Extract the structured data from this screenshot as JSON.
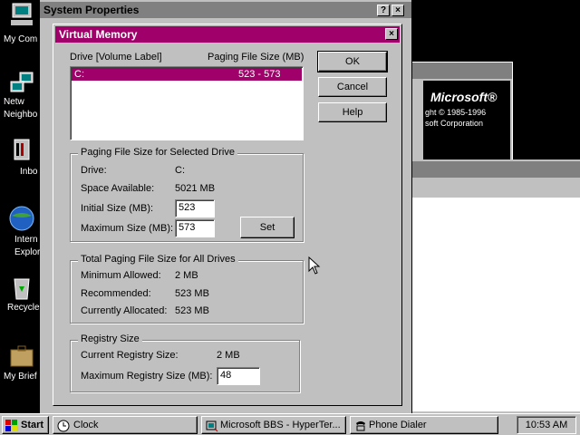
{
  "desktop": {
    "icons": [
      {
        "label": "My Com",
        "icon": "my-computer-icon"
      },
      {
        "label": "Netw\nNeighbo",
        "icon": "network-neighborhood-icon"
      },
      {
        "label": "Inbo",
        "icon": "inbox-icon"
      },
      {
        "label": "Intern\nExplor",
        "icon": "internet-explorer-icon"
      },
      {
        "label": "Recycle",
        "icon": "recycle-bin-icon"
      },
      {
        "label": "My Brief",
        "icon": "briefcase-icon"
      }
    ]
  },
  "system_properties": {
    "title": "System Properties",
    "help_glyph": "?",
    "close_glyph": "×"
  },
  "about_window": {
    "brand": "Microsoft®",
    "copyright": "ght © 1985-1996",
    "corp": "soft Corporation"
  },
  "virtual_memory": {
    "title": "Virtual Memory",
    "list_header": {
      "drive": "Drive  [Volume Label]",
      "paging": "Paging File Size (MB)"
    },
    "drives": [
      {
        "drive": "C:",
        "size": "523 - 573",
        "selected": true
      }
    ],
    "buttons": {
      "ok": "OK",
      "cancel": "Cancel",
      "help": "Help",
      "set": "Set"
    },
    "selected_drive_group": {
      "title": "Paging File Size for Selected Drive",
      "drive_label": "Drive:",
      "drive_value": "C:",
      "space_label": "Space Available:",
      "space_value": "5021 MB",
      "initial_label": "Initial Size (MB):",
      "initial_value": "523",
      "max_label": "Maximum Size (MB):",
      "max_value": "573"
    },
    "total_group": {
      "title": "Total Paging File Size for All Drives",
      "min_label": "Minimum Allowed:",
      "min_value": "2 MB",
      "rec_label": "Recommended:",
      "rec_value": "523 MB",
      "alloc_label": "Currently Allocated:",
      "alloc_value": "523 MB"
    },
    "registry_group": {
      "title": "Registry Size",
      "current_label": "Current Registry Size:",
      "current_value": "2 MB",
      "max_label": "Maximum Registry Size (MB):",
      "max_value": "48"
    }
  },
  "taskbar": {
    "start": "Start",
    "items": [
      {
        "label": "Clock",
        "icon": "clock-icon"
      },
      {
        "label": "Microsoft BBS - HyperTer...",
        "icon": "hyperterminal-icon"
      },
      {
        "label": "Phone Dialer",
        "icon": "phone-dialer-icon"
      }
    ],
    "time": "10:53 AM"
  },
  "colors": {
    "title_active": "#a0006a",
    "title_inactive": "#808080",
    "face": "#c0c0c0",
    "selection": "#a0006a"
  }
}
